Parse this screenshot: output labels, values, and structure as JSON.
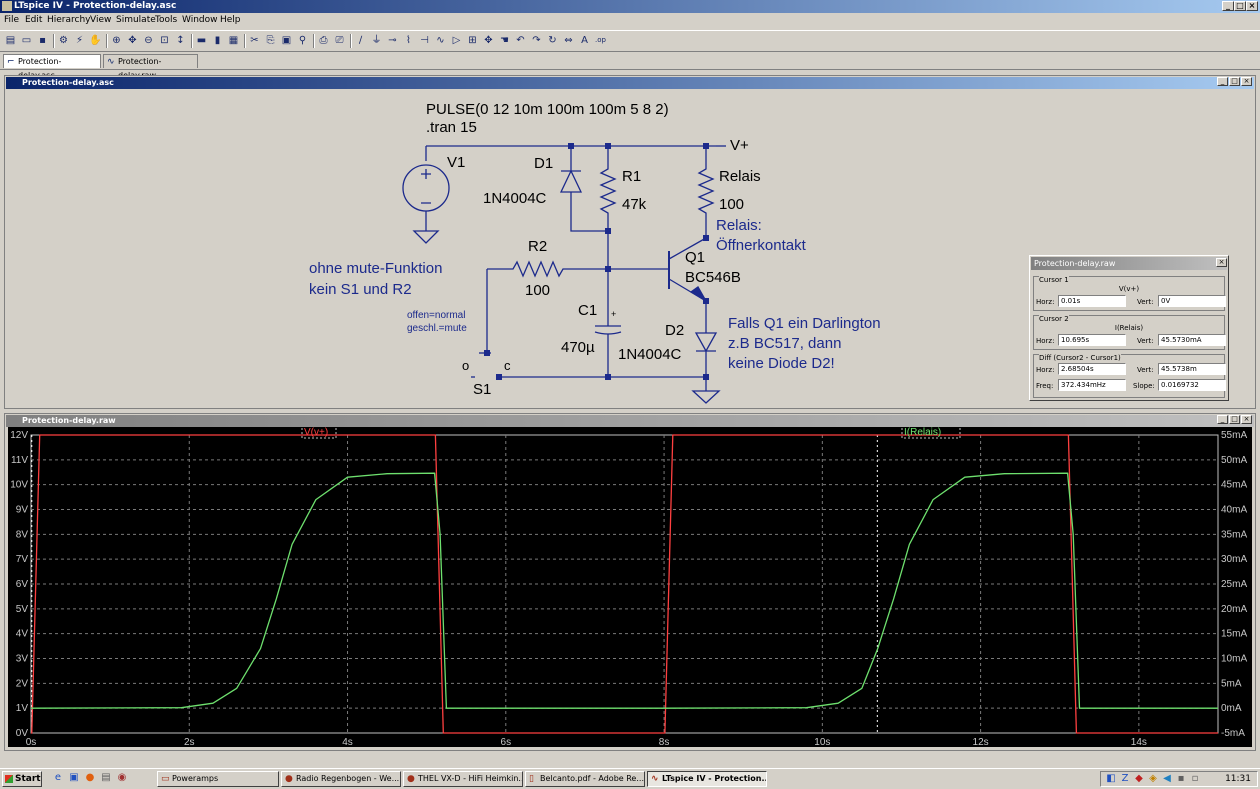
{
  "app": {
    "title": "LTspice IV - Protection-delay.asc",
    "window_controls": [
      "_",
      "□",
      "×"
    ]
  },
  "menu": [
    "File",
    "Edit",
    "Hierarchy",
    "View",
    "Simulate",
    "Tools",
    "Window",
    "Help"
  ],
  "toolbar_icons": [
    "new-schematic-icon",
    "open-icon",
    "save-icon",
    "control-panel-icon",
    "run-icon",
    "halt-icon",
    "zoom-in-icon",
    "pan-icon",
    "zoom-out-icon",
    "zoom-fit-icon",
    "autorange-icon",
    "tile-horizontal-icon",
    "tile-vertical-icon",
    "cascade-icon",
    "cut-icon",
    "copy-icon",
    "paste-icon",
    "find-icon",
    "print-icon",
    "print-preview-icon",
    "wire-icon",
    "ground-icon",
    "label-icon",
    "resistor-icon",
    "capacitor-icon",
    "inductor-icon",
    "diode-icon",
    "component-icon",
    "move-icon",
    "drag-icon",
    "undo-icon",
    "redo-icon",
    "rotate-icon",
    "mirror-icon",
    "text-icon",
    "spice-directive-icon"
  ],
  "tabs": [
    "Protection-delay.asc",
    "Protection-delay.raw"
  ],
  "schematic": {
    "window_title": "Protection-delay.asc",
    "directives": [
      "PULSE(0 12 10m 100m 100m 5 8 2)",
      ".tran 15"
    ],
    "labels": {
      "v1": "V1",
      "vplus": "V+",
      "d1": "D1",
      "d1_model": "1N4004C",
      "r1": "R1",
      "r1_value": "47k",
      "relais": "Relais",
      "relais_value": "100",
      "relais_note": [
        "Relais:",
        "Öffnerkontakt"
      ],
      "r2": "R2",
      "r2_value": "100",
      "q1": "Q1",
      "q1_model": "BC546B",
      "c1": "C1",
      "c1_value": "470µ",
      "d2": "D2",
      "d2_model": "1N4004C",
      "s1": "S1",
      "s1_o": "o",
      "s1_c": "c",
      "mute_note": [
        "ohne mute-Funktion",
        "kein S1 und R2"
      ],
      "switch_note": [
        "offen=normal",
        "geschl.=mute"
      ],
      "darlington_note": [
        "Falls Q1 ein Darlington",
        "z.B BC517, dann",
        "keine Diode D2!"
      ],
      "plus": "+"
    }
  },
  "cursor_panel": {
    "title": "Protection-delay.raw",
    "cursor1": {
      "label": "Cursor 1",
      "trace": "V(v+)",
      "horz_label": "Horz:",
      "horz": "0.01s",
      "vert_label": "Vert:",
      "vert": "0V"
    },
    "cursor2": {
      "label": "Cursor 2",
      "trace": "I(Relais)",
      "horz_label": "Horz:",
      "horz": "10.695s",
      "vert_label": "Vert:",
      "vert": "45.5730mA"
    },
    "diff": {
      "label": "Diff (Cursor2 - Cursor1)",
      "horz_label": "Horz:",
      "horz": "2.68504s",
      "vert_label": "Vert:",
      "vert": "45.5738m",
      "freq_label": "Freq:",
      "freq": "372.434mHz",
      "slope_label": "Slope:",
      "slope": "0.0169732"
    }
  },
  "plot": {
    "window_title": "Protection-delay.raw"
  },
  "chart_data": {
    "type": "line",
    "title": "",
    "xlabel": "",
    "ylabel": "",
    "xlim": [
      0,
      15
    ],
    "ylim_left": [
      0,
      12
    ],
    "ylim_right": [
      -5,
      55
    ],
    "x_ticks": [
      "0s",
      "2s",
      "4s",
      "6s",
      "8s",
      "10s",
      "12s",
      "14s"
    ],
    "y_left_ticks": [
      "0V",
      "1V",
      "2V",
      "3V",
      "4V",
      "5V",
      "6V",
      "7V",
      "8V",
      "9V",
      "10V",
      "11V",
      "12V"
    ],
    "y_right_ticks": [
      "-5mA",
      "0mA",
      "5mA",
      "10mA",
      "15mA",
      "20mA",
      "25mA",
      "30mA",
      "35mA",
      "40mA",
      "45mA",
      "50mA",
      "55mA"
    ],
    "grid": true,
    "cursor_x": [
      0.01,
      10.695
    ],
    "series": [
      {
        "name": "V(v+)",
        "axis": "left",
        "color": "#ff4040",
        "x": [
          0,
          0.01,
          0.11,
          5.11,
          5.21,
          8.01,
          8.11,
          13.11,
          13.21,
          15
        ],
        "y": [
          0,
          0,
          12,
          12,
          0,
          0,
          12,
          12,
          0,
          0
        ]
      },
      {
        "name": "I(Relais)",
        "axis": "right",
        "color": "#6ee06e",
        "x": [
          0,
          1.9,
          2.3,
          2.6,
          2.9,
          3.1,
          3.3,
          3.6,
          4.0,
          4.5,
          5.1,
          5.17,
          5.25,
          8.0,
          9.8,
          10.2,
          10.5,
          10.7,
          10.9,
          11.1,
          11.4,
          11.8,
          12.3,
          13.1,
          13.17,
          13.25,
          15
        ],
        "y": [
          0,
          0.1,
          1,
          4,
          12,
          22,
          33,
          42,
          46.5,
          47.2,
          47.3,
          35,
          0,
          0,
          0.1,
          1,
          4,
          12,
          22,
          33,
          42,
          46.5,
          47.2,
          47.3,
          35,
          0,
          0
        ]
      }
    ]
  },
  "taskbar": {
    "start": "Start",
    "tasks": [
      "Poweramps",
      "Radio Regenbogen - We...",
      "THEL VX-D - HiFi Heimkin...",
      "Belcanto.pdf - Adobe Re...",
      "LTspice IV - Protection..."
    ],
    "clock": "11:31"
  }
}
